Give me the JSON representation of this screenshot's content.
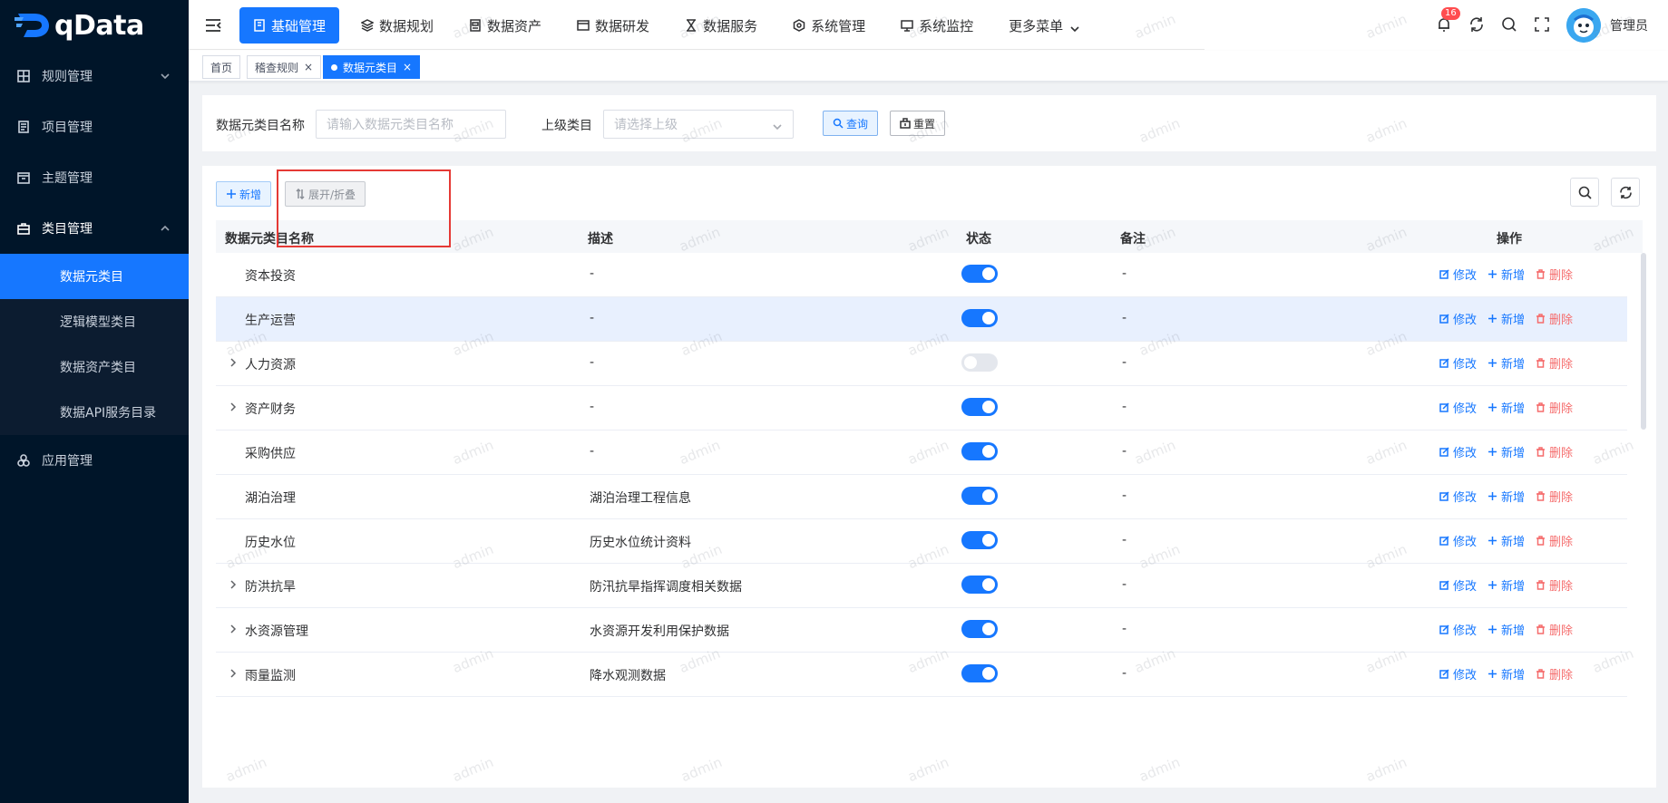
{
  "app": {
    "logo_text": "qData"
  },
  "sidebar": {
    "items": [
      {
        "label": "规则管理",
        "icon": "grid-icon",
        "has_chevron": true,
        "chevron": "down"
      },
      {
        "label": "项目管理",
        "icon": "document-icon"
      },
      {
        "label": "主题管理",
        "icon": "calendar-icon"
      },
      {
        "label": "类目管理",
        "icon": "briefcase-icon",
        "has_chevron": true,
        "chevron": "up",
        "open": true
      },
      {
        "label": "应用管理",
        "icon": "apps-icon"
      }
    ],
    "submenu": [
      {
        "label": "数据元类目",
        "active": true
      },
      {
        "label": "逻辑模型类目"
      },
      {
        "label": "数据资产类目"
      },
      {
        "label": "数据API服务目录"
      }
    ]
  },
  "topnav": {
    "items": [
      {
        "label": "基础管理",
        "icon": "book-icon",
        "active": true
      },
      {
        "label": "数据规划",
        "icon": "layers-icon"
      },
      {
        "label": "数据资产",
        "icon": "database-icon"
      },
      {
        "label": "数据研发",
        "icon": "window-icon"
      },
      {
        "label": "数据服务",
        "icon": "hourglass-icon"
      },
      {
        "label": "系统管理",
        "icon": "hexagon-gear-icon"
      },
      {
        "label": "系统监控",
        "icon": "monitor-icon"
      },
      {
        "label": "更多菜单",
        "icon": "",
        "more": true
      }
    ],
    "notification_count": "16",
    "username": "管理员"
  },
  "tags": [
    {
      "label": "首页"
    },
    {
      "label": "稽查规则",
      "closable": true
    },
    {
      "label": "数据元类目",
      "closable": true,
      "active": true
    }
  ],
  "search": {
    "name_label": "数据元类目名称",
    "name_placeholder": "请输入数据元类目名称",
    "parent_label": "上级类目",
    "parent_placeholder": "请选择上级",
    "query_label": "查询",
    "reset_label": "重置"
  },
  "toolbar": {
    "add_label": "新增",
    "toggle_label": "展开/折叠"
  },
  "table": {
    "columns": [
      "数据元类目名称",
      "描述",
      "状态",
      "备注",
      "操作"
    ],
    "actions": {
      "edit": "修改",
      "add": "新增",
      "delete": "删除"
    },
    "rows": [
      {
        "name": "资本投资",
        "desc": "-",
        "enabled": true,
        "remark": "-",
        "expandable": false
      },
      {
        "name": "生产运营",
        "desc": "-",
        "enabled": true,
        "remark": "-",
        "expandable": false,
        "hover": true
      },
      {
        "name": "人力资源",
        "desc": "-",
        "enabled": false,
        "remark": "-",
        "expandable": true
      },
      {
        "name": "资产财务",
        "desc": "-",
        "enabled": true,
        "remark": "-",
        "expandable": true
      },
      {
        "name": "采购供应",
        "desc": "-",
        "enabled": true,
        "remark": "-",
        "expandable": false
      },
      {
        "name": "湖泊治理",
        "desc": "湖泊治理工程信息",
        "enabled": true,
        "remark": "-",
        "expandable": false
      },
      {
        "name": "历史水位",
        "desc": "历史水位统计资料",
        "enabled": true,
        "remark": "-",
        "expandable": false
      },
      {
        "name": "防洪抗旱",
        "desc": "防汛抗旱指挥调度相关数据",
        "enabled": true,
        "remark": "-",
        "expandable": true
      },
      {
        "name": "水资源管理",
        "desc": "水资源开发利用保护数据",
        "enabled": true,
        "remark": "-",
        "expandable": true
      },
      {
        "name": "雨量监测",
        "desc": "降水观测数据",
        "enabled": true,
        "remark": "-",
        "expandable": true
      }
    ]
  },
  "watermark_text": "admin",
  "colors": {
    "primary": "#1677ff",
    "sidebar_bg": "#001529",
    "danger": "#f56c6c",
    "highlight_box": "#e53935"
  }
}
